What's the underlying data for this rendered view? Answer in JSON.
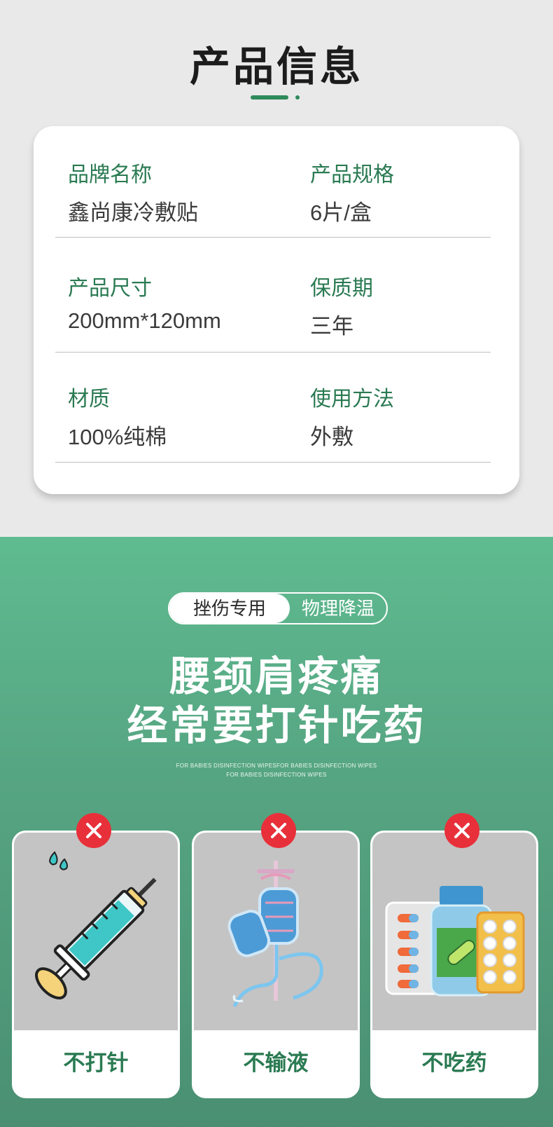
{
  "title": "产品信息",
  "specs": [
    {
      "label": "品牌名称",
      "value": "鑫尚康冷敷贴"
    },
    {
      "label": "产品规格",
      "value": "6片/盒"
    },
    {
      "label": "产品尺寸",
      "value": "200mm*120mm"
    },
    {
      "label": "保质期",
      "value": "三年"
    },
    {
      "label": "材质",
      "value": "100%纯棉"
    },
    {
      "label": "使用方法",
      "value": "外敷"
    }
  ],
  "tags": {
    "left": "挫伤专用",
    "right": "物理降温"
  },
  "headline": {
    "line1": "腰颈肩疼痛",
    "line2": "经常要打针吃药"
  },
  "subtitle": {
    "line1": "FOR BABIES DISINFECTION WIPESFOR BABIES DISINFECTION WIPES",
    "line2": "FOR BABIES DISINFECTION WIPES"
  },
  "items": [
    {
      "label": "不打针",
      "icon": "syringe-icon"
    },
    {
      "label": "不输液",
      "icon": "iv-drip-icon"
    },
    {
      "label": "不吃药",
      "icon": "medicine-icon"
    }
  ],
  "colors": {
    "accent": "#2a7a52",
    "cross": "#e8303a",
    "green_top": "#5fbb90",
    "green_bottom": "#4a8f72"
  }
}
